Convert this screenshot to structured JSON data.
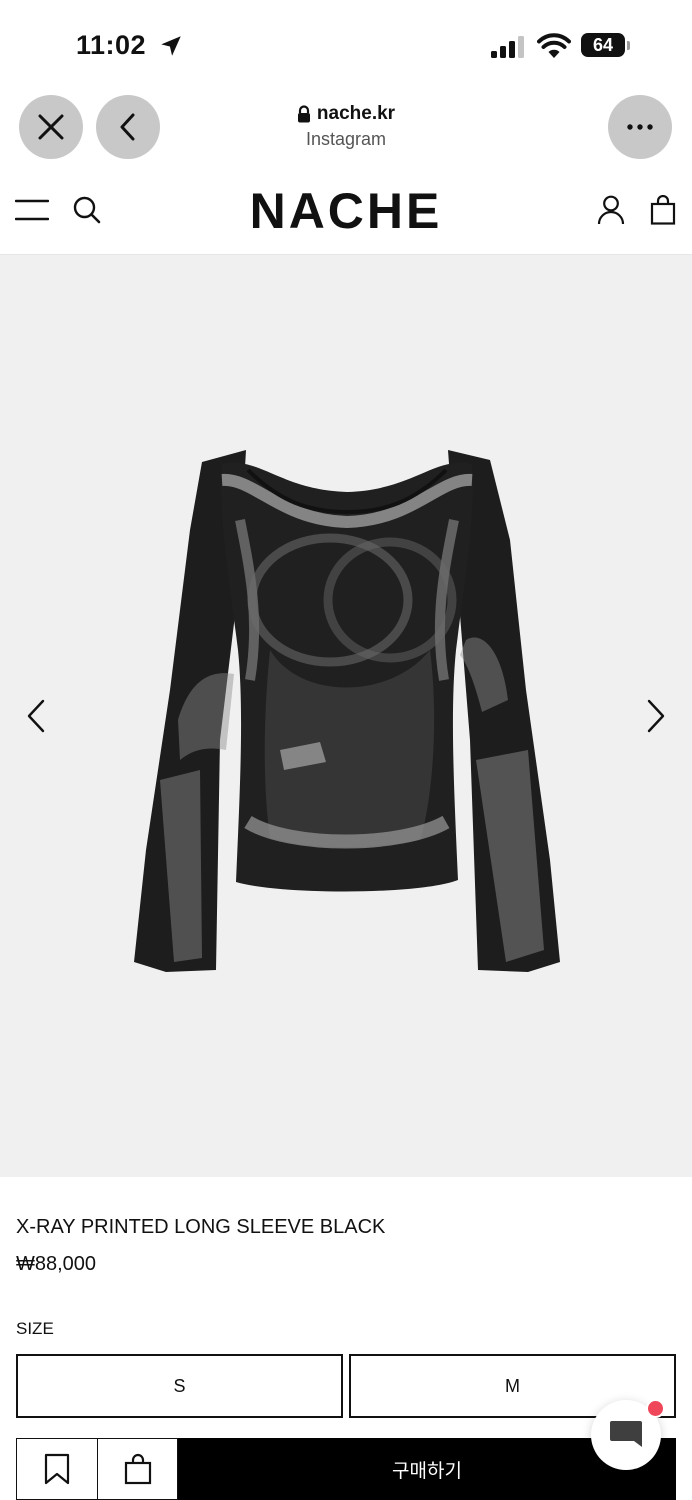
{
  "status_bar": {
    "time": "11:02",
    "battery": "64"
  },
  "browser": {
    "domain": "nache.kr",
    "source": "Instagram"
  },
  "site": {
    "logo": "NACHE"
  },
  "product": {
    "name": "X-RAY PRINTED LONG SLEEVE BLACK",
    "price": "₩88,000",
    "size_label": "SIZE",
    "sizes": [
      "S",
      "M"
    ],
    "buy_label": "구매하기"
  },
  "colors": {
    "accent": "#000000",
    "image_bg": "#f0f0f0",
    "badge": "#f0465a"
  },
  "icons": [
    "location-arrow-icon",
    "signal-icon",
    "wifi-icon",
    "battery-icon",
    "close-icon",
    "back-icon",
    "more-icon",
    "lock-icon",
    "menu-icon",
    "search-icon",
    "user-icon",
    "bag-icon",
    "chevron-left-icon",
    "chevron-right-icon",
    "bookmark-icon",
    "cart-icon",
    "chat-icon"
  ]
}
